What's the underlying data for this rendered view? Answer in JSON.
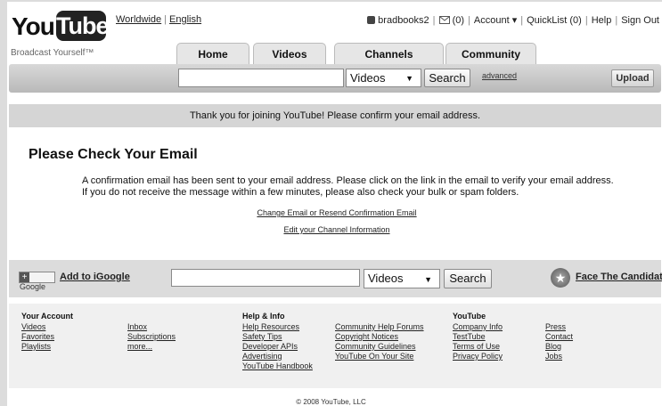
{
  "logo": {
    "part1": "You",
    "part2": "Tube",
    "tagline": "Broadcast Yourself™"
  },
  "lang": {
    "region": "Worldwide",
    "language": "English"
  },
  "util": {
    "user": "bradbooks2",
    "inbox": "(0)",
    "account": "Account ▾",
    "quicklist": "QuickList (0)",
    "help": "Help",
    "signout": "Sign Out"
  },
  "tabs": [
    "Home",
    "Videos",
    "Channels",
    "Community"
  ],
  "search": {
    "value": "",
    "scope": "Videos",
    "button": "Search",
    "advanced": "advanced",
    "upload": "Upload"
  },
  "notice": "Thank you for joining YouTube! Please confirm your email address.",
  "main": {
    "heading": "Please Check Your Email",
    "message": "A confirmation email has been sent to your email address. Please click on the link in the email to verify your email address. If you do not receive the message within a few minutes, please also check your bulk or spam folders.",
    "link_resend": "Change Email or Resend Confirmation Email",
    "link_channel": "Edit your Channel Information"
  },
  "bottombar": {
    "google_badge": "Google",
    "add_igoogle": "Add to iGoogle",
    "scope": "Videos",
    "button": "Search",
    "candidates": "Face The Candidates"
  },
  "footer": {
    "your_account": {
      "title": "Your Account",
      "col1": [
        "Videos",
        "Favorites",
        "Playlists"
      ],
      "col2": [
        "Inbox",
        "Subscriptions",
        "more..."
      ]
    },
    "help_info": {
      "title": "Help & Info",
      "col1": [
        "Help Resources",
        "Safety Tips",
        "Developer APIs",
        "Advertising",
        "YouTube Handbook"
      ],
      "col2": [
        "Community Help Forums",
        "Copyright Notices",
        "Community Guidelines",
        "YouTube On Your Site"
      ]
    },
    "youtube": {
      "title": "YouTube",
      "col1": [
        "Company Info",
        "TestTube",
        "Terms of Use",
        "Privacy Policy"
      ],
      "col2": [
        "Press",
        "Contact",
        "Blog",
        "Jobs"
      ]
    },
    "copyright": "© 2008 YouTube, LLC"
  }
}
